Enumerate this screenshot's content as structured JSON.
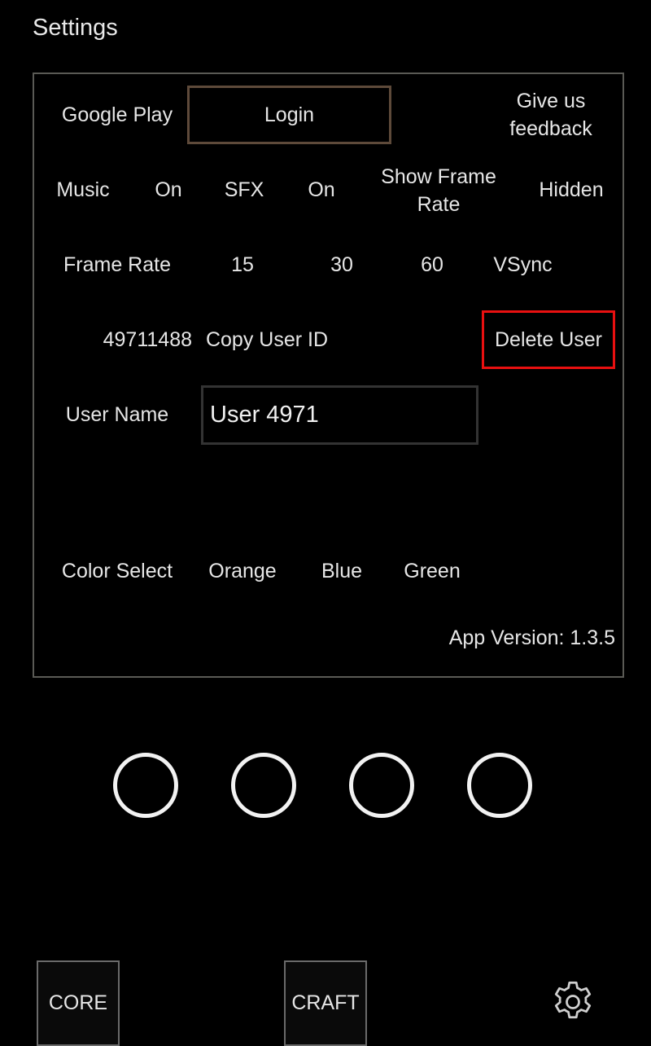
{
  "header": {
    "title": "Settings"
  },
  "colors": {
    "accent": "#f26a10",
    "danger": "#e81010",
    "login_border": "#5e4a3a",
    "panel_border": "#5a5a55",
    "input_border": "#333333"
  },
  "settings": {
    "google_play": {
      "label": "Google Play",
      "login_label": "Login"
    },
    "feedback": {
      "label": "Give us feedback"
    },
    "music": {
      "label": "Music",
      "value": "On"
    },
    "sfx": {
      "label": "SFX",
      "value": "On"
    },
    "show_frame_rate": {
      "label": "Show Frame Rate",
      "value": "Hidden"
    },
    "frame_rate": {
      "label": "Frame Rate",
      "options": [
        "15",
        "30",
        "60",
        "VSync"
      ],
      "selected": "VSync"
    },
    "user_id": {
      "value": "49711488",
      "copy_label": "Copy User ID",
      "delete_label": "Delete User"
    },
    "user_name": {
      "label": "User Name",
      "value": "User 4971"
    },
    "color_select": {
      "label": "Color Select",
      "options": [
        "Orange",
        "Blue",
        "Green"
      ],
      "selected": "Orange"
    },
    "app_version": "App Version: 1.3.5"
  },
  "page_indicators": [
    {
      "name": "slot-1"
    },
    {
      "name": "slot-2"
    },
    {
      "name": "slot-3"
    },
    {
      "name": "slot-4"
    }
  ],
  "bottom_nav": {
    "core_label": "CORE",
    "craft_label": "CRAFT",
    "settings_icon": "gear-icon"
  }
}
